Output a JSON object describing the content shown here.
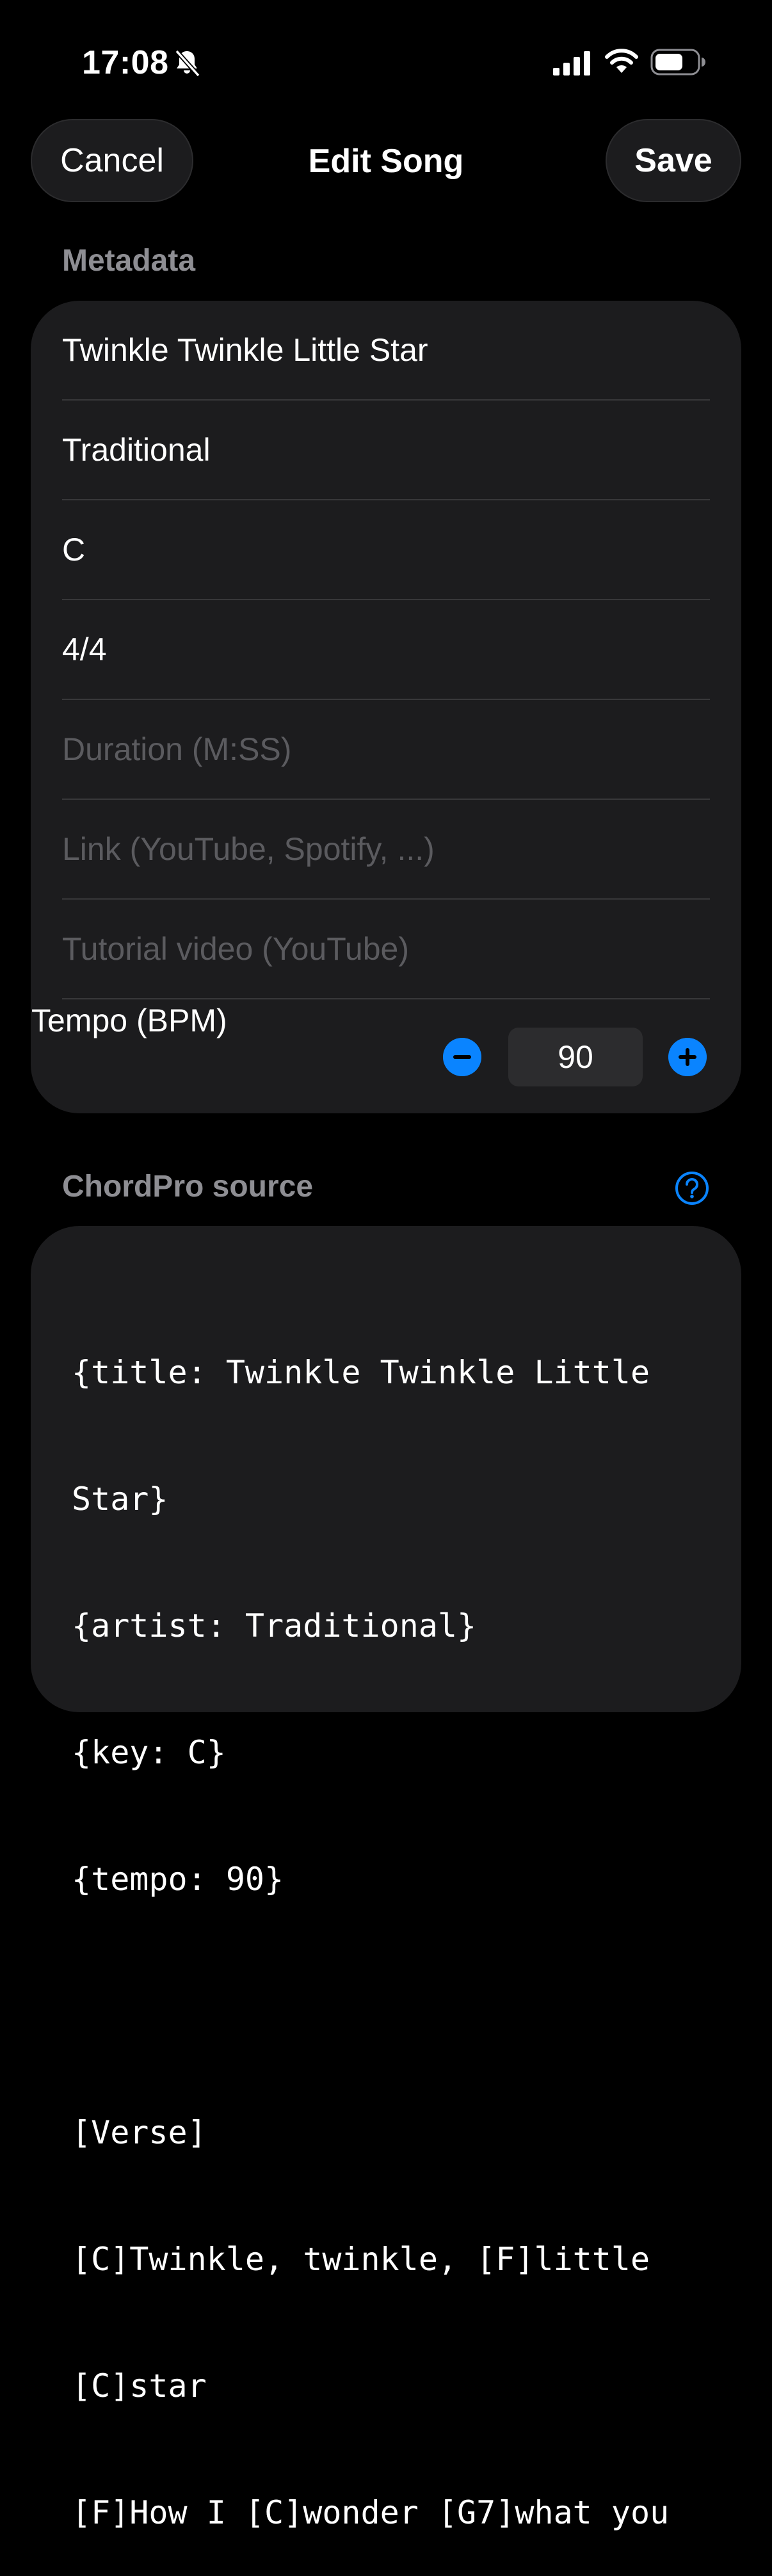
{
  "status_bar": {
    "time": "17:08"
  },
  "nav": {
    "cancel_label": "Cancel",
    "title": "Edit Song",
    "save_label": "Save"
  },
  "metadata": {
    "header": "Metadata",
    "fields": {
      "title": "Twinkle Twinkle Little Star",
      "artist": "Traditional",
      "key": "C",
      "time_signature": "4/4",
      "duration_placeholder": "Duration (M:SS)",
      "link_placeholder": "Link (YouTube, Spotify, ...)",
      "tutorial_placeholder": "Tutorial video (YouTube)"
    },
    "tempo": {
      "label": "Tempo (BPM)",
      "value": "90"
    }
  },
  "source": {
    "header": "ChordPro source",
    "lines": [
      "{title: Twinkle Twinkle Little",
      "Star}",
      "{artist: Traditional}",
      "{key: C}",
      "{tempo: 90}",
      "",
      "[Verse]",
      "[C]Twinkle, twinkle, [F]little",
      "[C]star",
      "[F]How I [C]wonder [G7]what you"
    ]
  },
  "colors": {
    "background": "#000000",
    "card": "#1c1c1e",
    "accent": "#0a84ff",
    "secondary_text": "#8e8e93",
    "placeholder": "#5b5b5f"
  },
  "icons": {
    "status": [
      "bell-slash-icon",
      "cellular-signal-icon",
      "wifi-icon",
      "battery-icon"
    ],
    "stepper": [
      "minus-circle-icon",
      "plus-circle-icon"
    ],
    "help": "question-circle-icon"
  }
}
